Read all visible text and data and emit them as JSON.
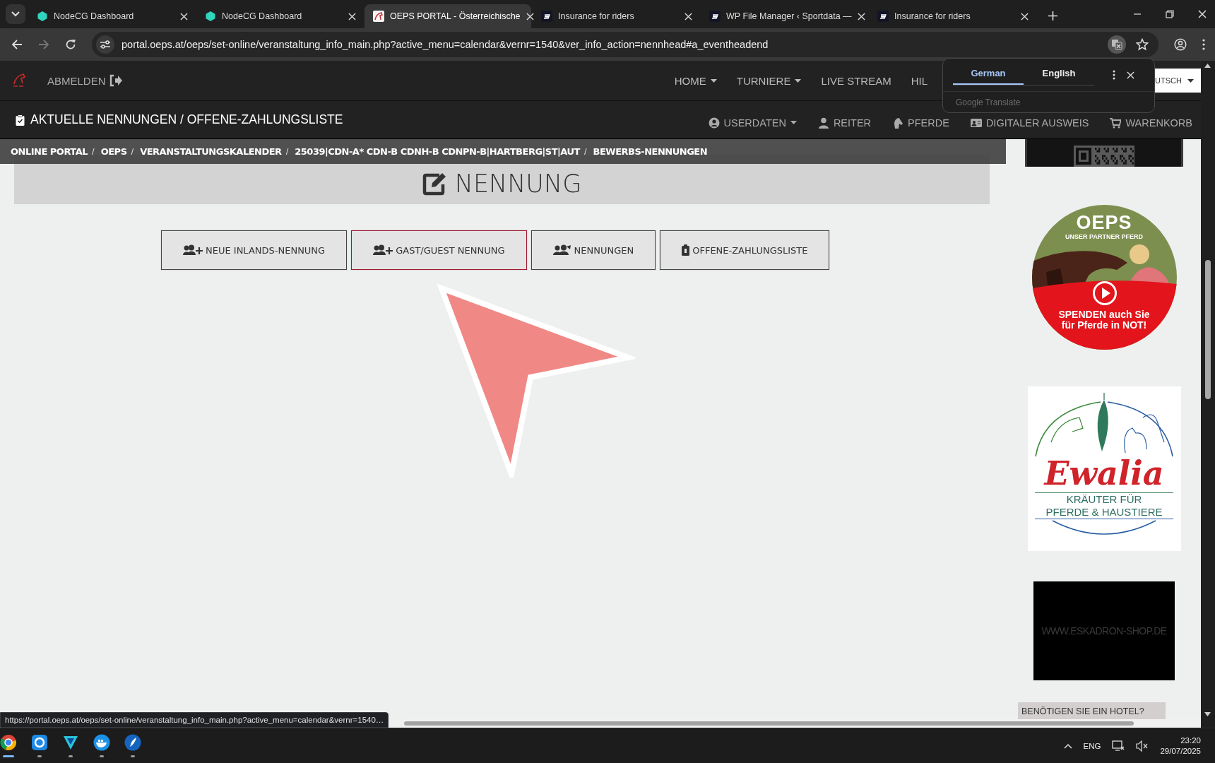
{
  "browser": {
    "tabs": [
      {
        "title": "NodeCG Dashboard",
        "kind": "hexagon",
        "selected": false
      },
      {
        "title": "NodeCG Dashboard",
        "kind": "hexagon",
        "selected": false
      },
      {
        "title": "OEPS PORTAL - Österreichische",
        "kind": "horse",
        "selected": true
      },
      {
        "title": "Insurance for riders",
        "kind": "stripes",
        "selected": false
      },
      {
        "title": "WP File Manager ‹ Sportdata —",
        "kind": "stripes",
        "selected": false
      },
      {
        "title": "Insurance for riders",
        "kind": "stripes",
        "selected": false
      }
    ],
    "address": "portal.oeps.at/oeps/set-online/veranstaltung_info_main.php?active_menu=calendar&vernr=1540&ver_info_action=nennhead#a_eventheadend"
  },
  "site": {
    "logout": "ABMELDEN",
    "nav": [
      {
        "label": "HOME",
        "dropdown": true
      },
      {
        "label": "TURNIERE",
        "dropdown": true
      },
      {
        "label": "LIVE STREAM",
        "dropdown": false
      },
      {
        "label": "HIL",
        "dropdown": false
      }
    ],
    "language": "UTSCH",
    "section_title": "AKTUELLE NENNUNGEN / OFFENE-ZAHLUNGSLISTE",
    "user_nav": [
      {
        "label": "USERDATEN",
        "kind": "user-circle",
        "dropdown": true
      },
      {
        "label": "REITER",
        "kind": "user",
        "dropdown": false
      },
      {
        "label": "PFERDE",
        "kind": "horse",
        "dropdown": false
      },
      {
        "label": "DIGITALER AUSWEIS",
        "kind": "id-card",
        "dropdown": false
      },
      {
        "label": "WARENKORB",
        "kind": "cart",
        "dropdown": false
      }
    ],
    "breadcrumb": {
      "separator": "/",
      "items": [
        "ONLINE PORTAL",
        "OEPS",
        "VERANSTALTUNGSKALENDER",
        "25039|CDN-A* CDN-B CDNH-B CDNPN-B|HARTBERG|ST|AUT",
        "BEWERBS-NENNUNGEN"
      ]
    }
  },
  "content": {
    "heading": "NENNUNG",
    "buttons": [
      {
        "label": "NEUE INLANDS-NENNUNG",
        "kind": "user-plus",
        "selected": false
      },
      {
        "label": "GAST/GUEST NENNUNG",
        "kind": "user-plus",
        "selected": true
      },
      {
        "label": "NENNUNGEN",
        "kind": "users",
        "selected": false
      },
      {
        "label": "OFFENE-ZAHLUNGSLISTE",
        "kind": "clipboard",
        "selected": false
      }
    ]
  },
  "sidebar": {
    "ads": [
      {
        "kind": "qr"
      },
      {
        "kind": "oeps",
        "logo": "OEPS",
        "tagline": "UNSER PARTNER PFERD",
        "text": "SPENDEN auch Sie für Pferde in NOT!"
      },
      {
        "kind": "ewalia",
        "brand": "Ewalia",
        "lines": [
          "KRÄUTER FÜR",
          "PFERDE & HAUSTIERE"
        ]
      },
      {
        "kind": "eskadron",
        "text": "WWW.ESKADRON-SHOP.DE"
      },
      {
        "kind": "hotel",
        "text": "BENÖTIGEN SIE EIN HOTEL?"
      }
    ]
  },
  "translate_popup": {
    "languages": [
      {
        "label": "German",
        "selected": true
      },
      {
        "label": "English",
        "selected": false
      }
    ],
    "footer": "Google Translate"
  },
  "status_url": "https://portal.oeps.at/oeps/set-online/veranstaltung_info_main.php?active_menu=calendar&vernr=1540…",
  "taskbar": {
    "apps": [
      {
        "kind": "browser",
        "active": true
      },
      {
        "kind": "sync",
        "active": false
      },
      {
        "kind": "shield",
        "active": false
      },
      {
        "kind": "whale",
        "active": false
      },
      {
        "kind": "feather",
        "active": false
      }
    ],
    "language": "ENG",
    "time": "23:20",
    "date": "29/07/2025"
  }
}
